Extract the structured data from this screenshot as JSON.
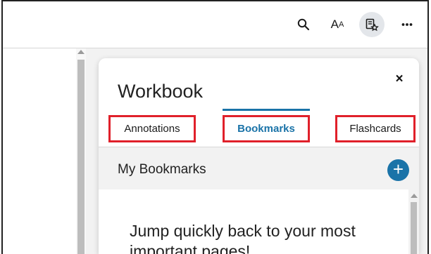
{
  "toolbar": {
    "search_icon": "search-icon",
    "text_size_label_big": "A",
    "text_size_label_small": "A",
    "workbook_icon": "workbook-star-icon",
    "more_icon": "more-horizontal-icon"
  },
  "panel": {
    "title": "Workbook",
    "close_label": "×",
    "tabs": [
      {
        "label": "Annotations"
      },
      {
        "label": "Bookmarks"
      },
      {
        "label": "Flashcards"
      }
    ],
    "active_tab": "Bookmarks",
    "section_title": "My Bookmarks",
    "add_label": "+",
    "empty_message": "Jump quickly back to your most important pages!"
  },
  "colors": {
    "accent": "#1a73a8",
    "highlight_box": "#e0202a"
  }
}
